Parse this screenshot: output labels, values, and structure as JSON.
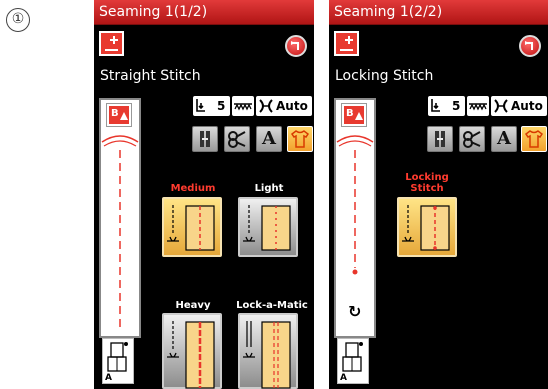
{
  "step_marker": "①",
  "screen1": {
    "title": "Seaming 1(1/2)",
    "stitch_name": "Straight Stitch",
    "presser_value": "5",
    "thread_label": "Auto",
    "preview_button_label": "B",
    "foot_letter": "A",
    "options": [
      {
        "label": "Medium",
        "selected": true
      },
      {
        "label": "Light",
        "selected": false
      },
      {
        "label": "Heavy",
        "selected": false
      },
      {
        "label": "Lock-a-Matic",
        "selected": false
      }
    ]
  },
  "screen2": {
    "title": "Seaming 1(2/2)",
    "stitch_name": "Locking Stitch",
    "presser_value": "5",
    "thread_label": "Auto",
    "preview_button_label": "B",
    "foot_letter": "A",
    "options": [
      {
        "label_line1": "Locking",
        "label_line2": "Stitch",
        "selected": true
      }
    ]
  },
  "colors": {
    "title_red": "#d42020",
    "selected_label": "#ff3b2f",
    "unselected_label": "#ffffff",
    "accent_yellow": "#f2b640",
    "stitch_red": "#e8352b"
  },
  "icons": [
    "mode-toggle-icon",
    "back-icon",
    "presser-foot-height-icon",
    "feed-dog-icon",
    "thread-tension-icon",
    "needle-position-icon",
    "thread-cutter-icon",
    "font-icon",
    "garment-icon",
    "presser-foot-icon",
    "reverse-icon"
  ]
}
